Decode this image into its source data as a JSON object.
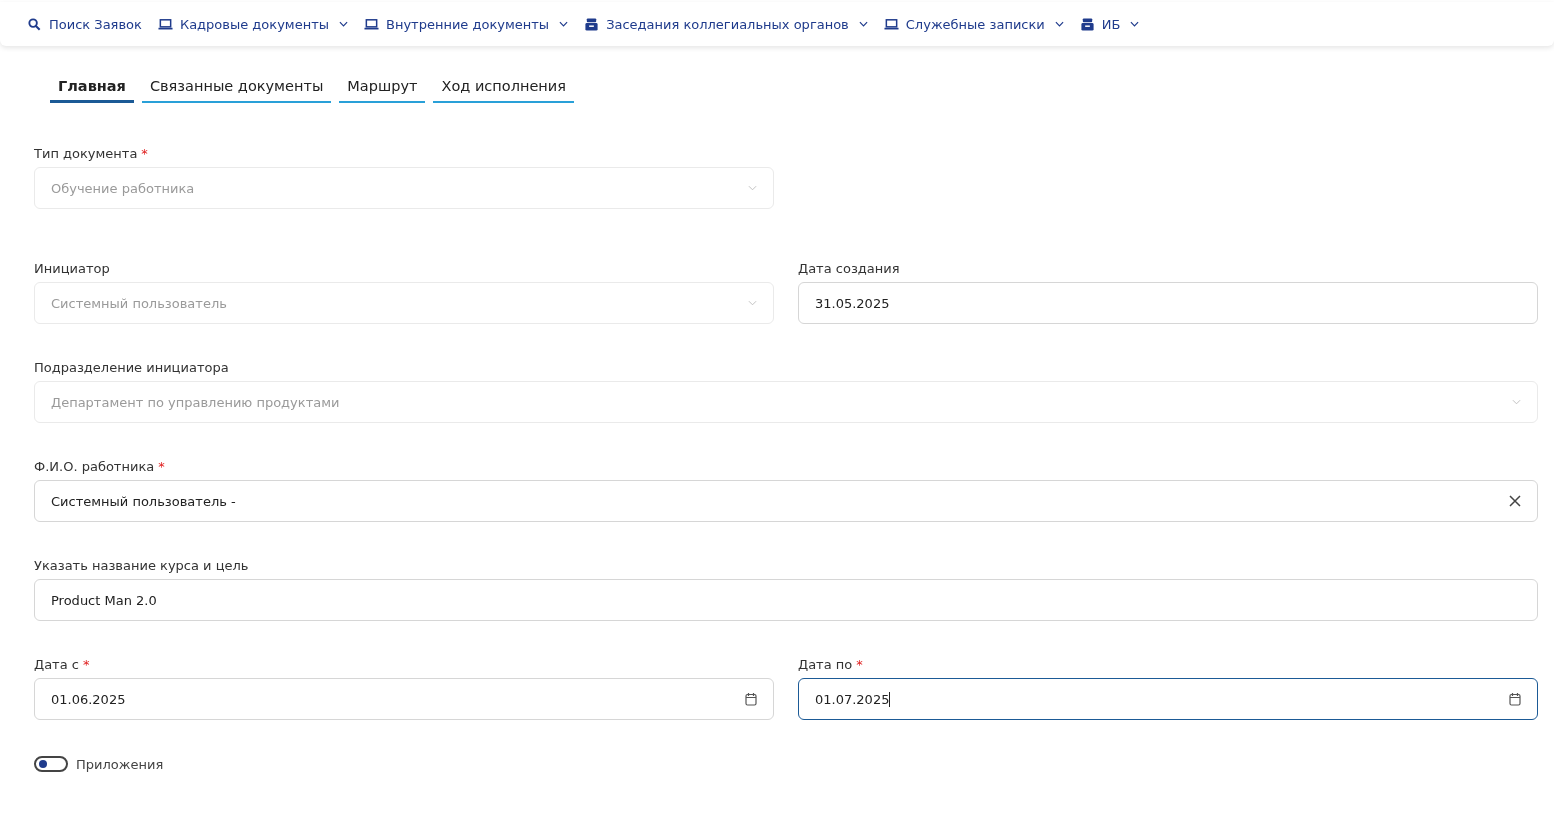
{
  "nav": [
    {
      "label": "Поиск Заявок",
      "kind": "search",
      "dropdown": false
    },
    {
      "label": "Кадровые документы",
      "kind": "docs",
      "dropdown": true
    },
    {
      "label": "Внутренние документы",
      "kind": "docs",
      "dropdown": true
    },
    {
      "label": "Заседания коллегиальных органов",
      "kind": "archive",
      "dropdown": true
    },
    {
      "label": "Служебные записки",
      "kind": "docs",
      "dropdown": true
    },
    {
      "label": "ИБ",
      "kind": "archive",
      "dropdown": true
    }
  ],
  "tabs": [
    {
      "label": "Главная",
      "selected": true
    },
    {
      "label": "Связанные документы",
      "selected": false
    },
    {
      "label": "Маршрут",
      "selected": false
    },
    {
      "label": "Ход исполнения",
      "selected": false
    }
  ],
  "rows": [
    {
      "fields": [
        {
          "kind": "select",
          "label": "Тип документа",
          "required_mark": "*",
          "value": "Обучение работника",
          "disabled": true,
          "focused": false
        },
        {
          "kind": "empty"
        }
      ]
    },
    {
      "fields": [
        {
          "kind": "select",
          "label": "Инициатор",
          "value": "Системный пользователь",
          "disabled": true,
          "focused": false
        },
        {
          "kind": "text",
          "label": "Дата создания",
          "value": "31.05.2025",
          "disabled": false,
          "focused": false
        }
      ]
    },
    {
      "fields": [
        {
          "kind": "select",
          "label": "Подразделение инициатора",
          "value": "Департамент по управлению продуктами",
          "disabled": true,
          "focused": false
        }
      ]
    },
    {
      "fields": [
        {
          "kind": "clearable",
          "label": "Ф.И.О. работника",
          "required_mark": "*",
          "value": "Системный пользователь -",
          "disabled": false,
          "focused": false
        }
      ]
    },
    {
      "fields": [
        {
          "kind": "text",
          "label": "Указать название курса и цель",
          "value": "Product Man 2.0",
          "disabled": false,
          "focused": false
        }
      ]
    },
    {
      "fields": [
        {
          "kind": "date",
          "label": "Дата с",
          "required_mark": "*",
          "value": "01.06.2025",
          "disabled": false,
          "focused": false
        },
        {
          "kind": "date",
          "label": "Дата по",
          "required_mark": "*",
          "value": "01.07.2025",
          "disabled": false,
          "focused": true
        }
      ]
    }
  ],
  "toggle": {
    "label": "Приложения",
    "on": false
  }
}
